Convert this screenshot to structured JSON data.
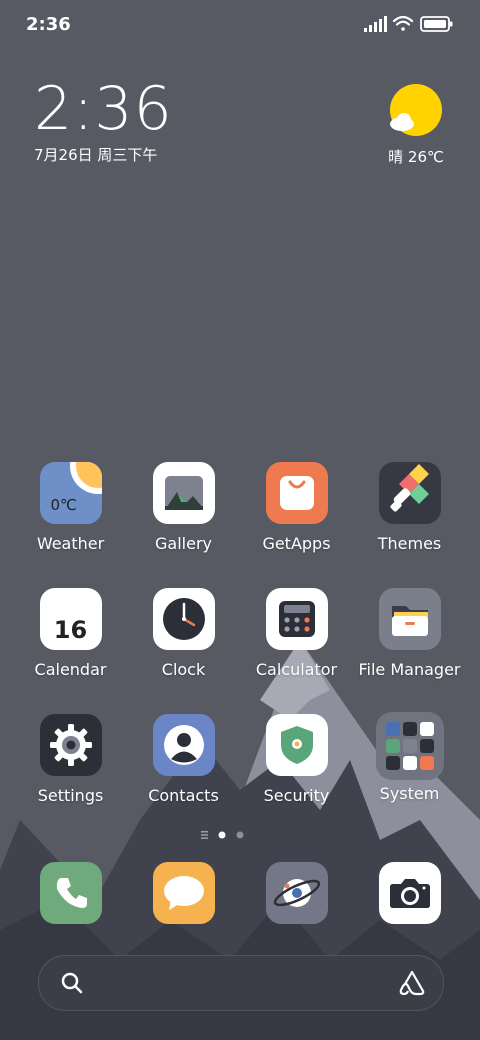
{
  "status_bar": {
    "time": "2:36"
  },
  "clock_widget": {
    "time": "2:36",
    "date": "7月26日 周三下午"
  },
  "weather_widget": {
    "summary": "晴 26℃"
  },
  "apps": {
    "row1": [
      {
        "label": "Weather",
        "icon": "weather-icon",
        "icon_text": "0℃"
      },
      {
        "label": "Gallery",
        "icon": "gallery-icon"
      },
      {
        "label": "GetApps",
        "icon": "shopping-bag-icon"
      },
      {
        "label": "Themes",
        "icon": "brush-icon"
      }
    ],
    "row2": [
      {
        "label": "Calendar",
        "icon": "calendar-icon",
        "icon_text": "16"
      },
      {
        "label": "Clock",
        "icon": "clock-icon"
      },
      {
        "label": "Calculator",
        "icon": "calculator-icon"
      },
      {
        "label": "File Manager",
        "icon": "folder-icon"
      }
    ],
    "row3": [
      {
        "label": "Settings",
        "icon": "gear-icon"
      },
      {
        "label": "Contacts",
        "icon": "person-icon"
      },
      {
        "label": "Security",
        "icon": "shield-icon"
      },
      {
        "label": "System",
        "icon": "folder-grid-icon"
      }
    ]
  },
  "dock": [
    {
      "app": "phone",
      "icon": "phone-icon",
      "color": "#6faa7d"
    },
    {
      "app": "messages",
      "icon": "message-bubble-icon",
      "color": "#f7b250"
    },
    {
      "app": "browser",
      "icon": "planet-icon",
      "color": "#737787"
    },
    {
      "app": "camera",
      "icon": "camera-icon",
      "color": "#ffffff"
    }
  ],
  "pagination": {
    "pages": 2,
    "current": 1
  },
  "colors": {
    "background": "#575a63",
    "mountain": "#8d909c",
    "mountain_dark": "#3f414b",
    "sun": "#ffd200",
    "weather_tile": "#6f8fc9",
    "getapps_tile": "#f07a4f",
    "contacts_tile": "#6b86c6"
  }
}
